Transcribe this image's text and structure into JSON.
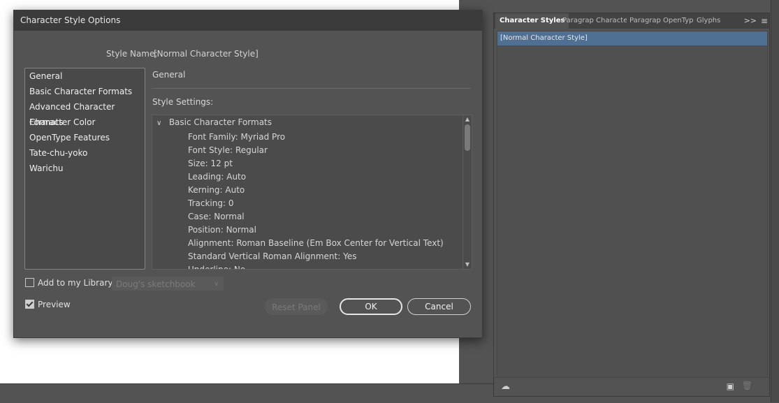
{
  "dialog": {
    "title": "Character Style Options",
    "style_name_label": "Style Name:",
    "style_name_value": "[Normal Character Style]",
    "categories": [
      "General",
      "Basic Character Formats",
      "Advanced Character Formats",
      "Character Color",
      "OpenType Features",
      "Tate-chu-yoko",
      "Warichu"
    ],
    "section_title": "General",
    "settings_label": "Style Settings:",
    "tree_header": "Basic Character Formats",
    "tree_rows": [
      "Font Family: Myriad Pro",
      "Font Style: Regular",
      "Size: 12 pt",
      "Leading: Auto",
      "Kerning: Auto",
      "Tracking: 0",
      "Case: Normal",
      "Position: Normal",
      "Alignment: Roman Baseline (Em Box Center for Vertical Text)",
      "Standard Vertical Roman Alignment: Yes",
      "Underline: No"
    ],
    "add_library_label": "Add to my Library",
    "library_select_value": "Doug's sketchbook",
    "preview_label": "Preview",
    "preview_checked": true,
    "add_library_checked": false,
    "buttons": {
      "reset": "Reset Panel",
      "ok": "OK",
      "cancel": "Cancel"
    }
  },
  "panel": {
    "tabs": [
      "Character Styles",
      "Paragrap",
      "Characte",
      "Paragrap",
      "OpenTyp",
      "Glyphs"
    ],
    "more_icon": ">>",
    "styles": [
      "[Normal Character Style]"
    ],
    "selection_color": "#4f6f93"
  }
}
